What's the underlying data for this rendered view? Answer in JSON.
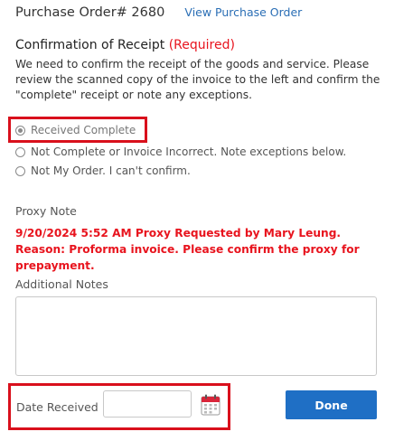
{
  "header": {
    "po_title": "Purchase Order# 2680",
    "view_link": "View Purchase Order"
  },
  "confirmation": {
    "title": "Confirmation of Receipt",
    "required": "(Required)",
    "description": "We need to confirm the receipt of the goods and service. Please review the scanned copy of the invoice to the left and confirm the \"complete\" receipt or note any exceptions.",
    "options": [
      {
        "label": "Received Complete",
        "selected": true
      },
      {
        "label": "Not Complete or Invoice Incorrect. Note exceptions below.",
        "selected": false
      },
      {
        "label": "Not My Order. I can't confirm.",
        "selected": false
      }
    ]
  },
  "proxy": {
    "title": "Proxy Note",
    "text": "9/20/2024 5:52 AM Proxy Requested by Mary Leung. Reason: Proforma invoice. Please confirm the proxy for prepayment."
  },
  "notes": {
    "title": "Additional Notes",
    "value": ""
  },
  "date": {
    "label": "Date Received",
    "value": ""
  },
  "actions": {
    "done_label": "Done"
  },
  "colors": {
    "accent_blue": "#1f6fc5",
    "required_red": "#e8141e",
    "highlight_red": "#d9101c",
    "link_blue": "#2a6eb5"
  },
  "icons": {
    "calendar": "calendar-icon"
  }
}
